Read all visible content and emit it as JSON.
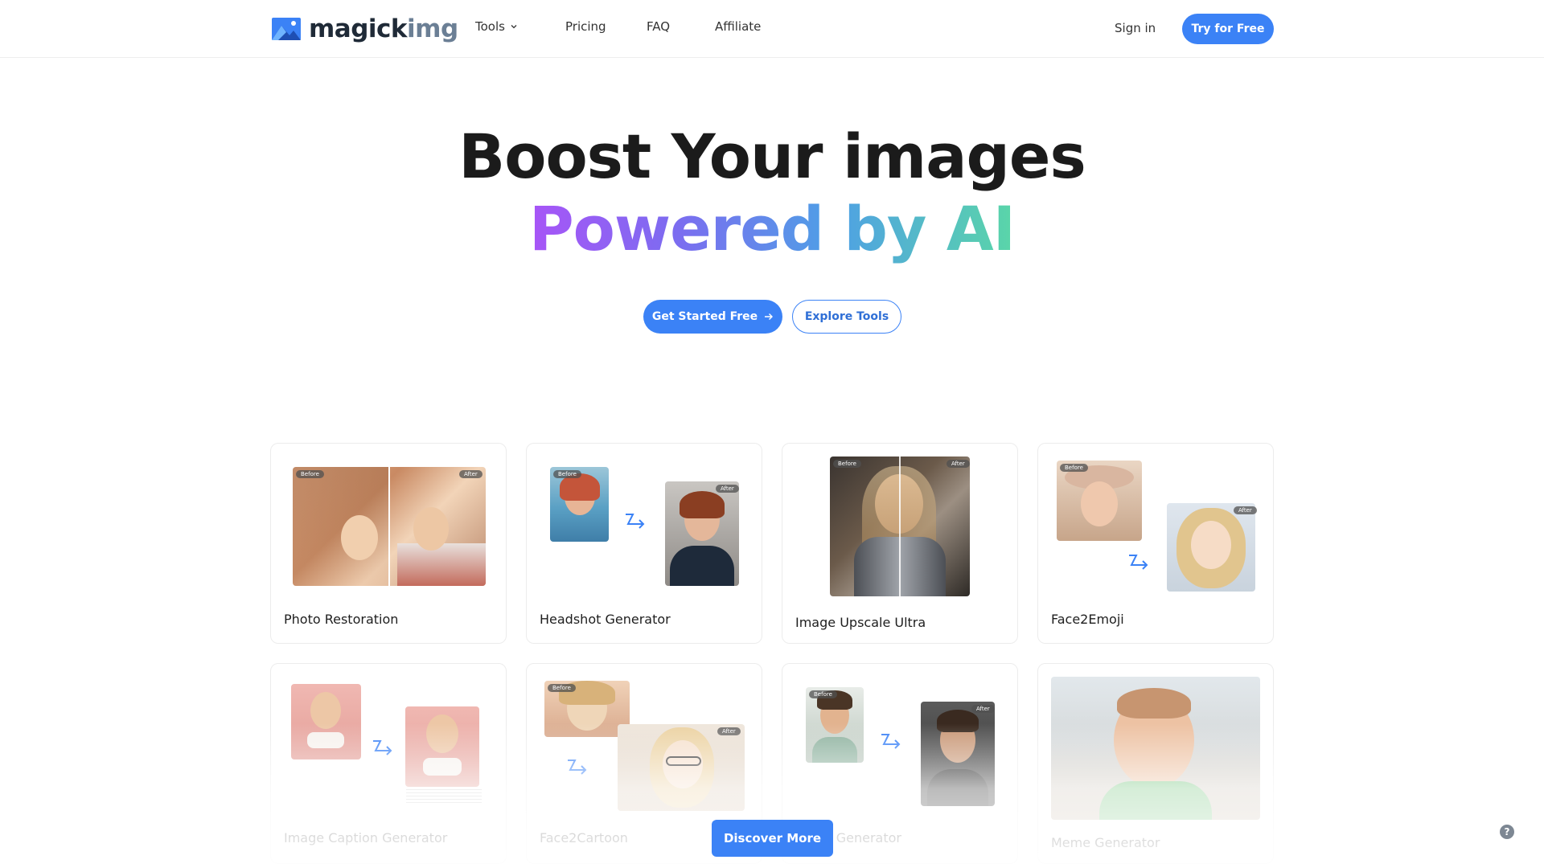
{
  "brand": {
    "name_part1": "magick",
    "name_part2": "img",
    "icon": "mountain-image-logo-icon"
  },
  "nav": {
    "tools": "Tools",
    "pricing": "Pricing",
    "faq": "FAQ",
    "affiliate": "Affiliate",
    "sign_in": "Sign in",
    "try_free": "Try for Free"
  },
  "hero": {
    "line1": "Boost Your images",
    "line2": "Powered by AI",
    "get_started": "Get Started Free",
    "explore": "Explore Tools"
  },
  "tools": [
    {
      "title": "Photo Restoration",
      "before": "Before",
      "after": "After"
    },
    {
      "title": "Headshot Generator",
      "before": "Before",
      "after": "After"
    },
    {
      "title": "Image Upscale Ultra",
      "before": "Before",
      "after": "After"
    },
    {
      "title": "Face2Emoji",
      "before": "Before",
      "after": "After"
    },
    {
      "title": "Image Caption Generator"
    },
    {
      "title": "Face2Cartoon",
      "before": "Before",
      "after": "After"
    },
    {
      "title": "Photo Generator",
      "before": "Before",
      "after": "After"
    },
    {
      "title": "Meme Generator"
    }
  ],
  "discover_more": "Discover More",
  "help": "?",
  "colors": {
    "accent": "#3b82f6",
    "gradient": [
      "#a855f7",
      "#4f9fe6",
      "#5ad6a8"
    ]
  }
}
